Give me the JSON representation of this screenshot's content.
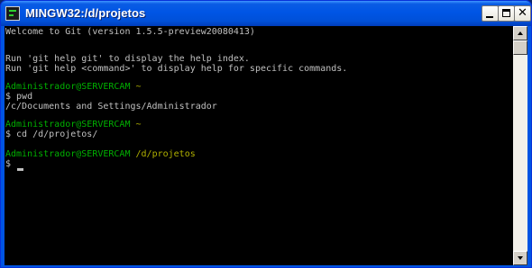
{
  "window": {
    "title": "MINGW32:/d/projetos"
  },
  "titlebar": {
    "app_icon": "terminal-icon",
    "minimize_icon": "minimize-icon",
    "maximize_icon": "maximize-icon",
    "close_icon": "close-icon",
    "close_glyph": "✕"
  },
  "console": {
    "welcome": "Welcome to Git (version 1.5.5-preview20080413)",
    "help_line_1": "Run 'git help git' to display the help index.",
    "help_line_2": "Run 'git help <command>' to display help for specific commands.",
    "prompt_1_user": "Administrador@SERVERCAM",
    "prompt_1_path": " ~",
    "cmd_1": "$ pwd",
    "output_1": "/c/Documents and Settings/Administrador",
    "prompt_2_user": "Administrador@SERVERCAM",
    "prompt_2_path": " ~",
    "cmd_2": "$ cd /d/projetos/",
    "prompt_3_user": "Administrador@SERVERCAM",
    "prompt_3_path": " /d/projetos",
    "cmd_3": "$ "
  },
  "colors": {
    "console_bg": "#000000",
    "console_text": "#c0c0c0",
    "prompt_user": "#00b000",
    "prompt_path": "#b0b000",
    "titlebar": "#0055e5"
  },
  "scrollbar": {
    "up_icon": "arrow-up-icon",
    "down_icon": "arrow-down-icon"
  }
}
